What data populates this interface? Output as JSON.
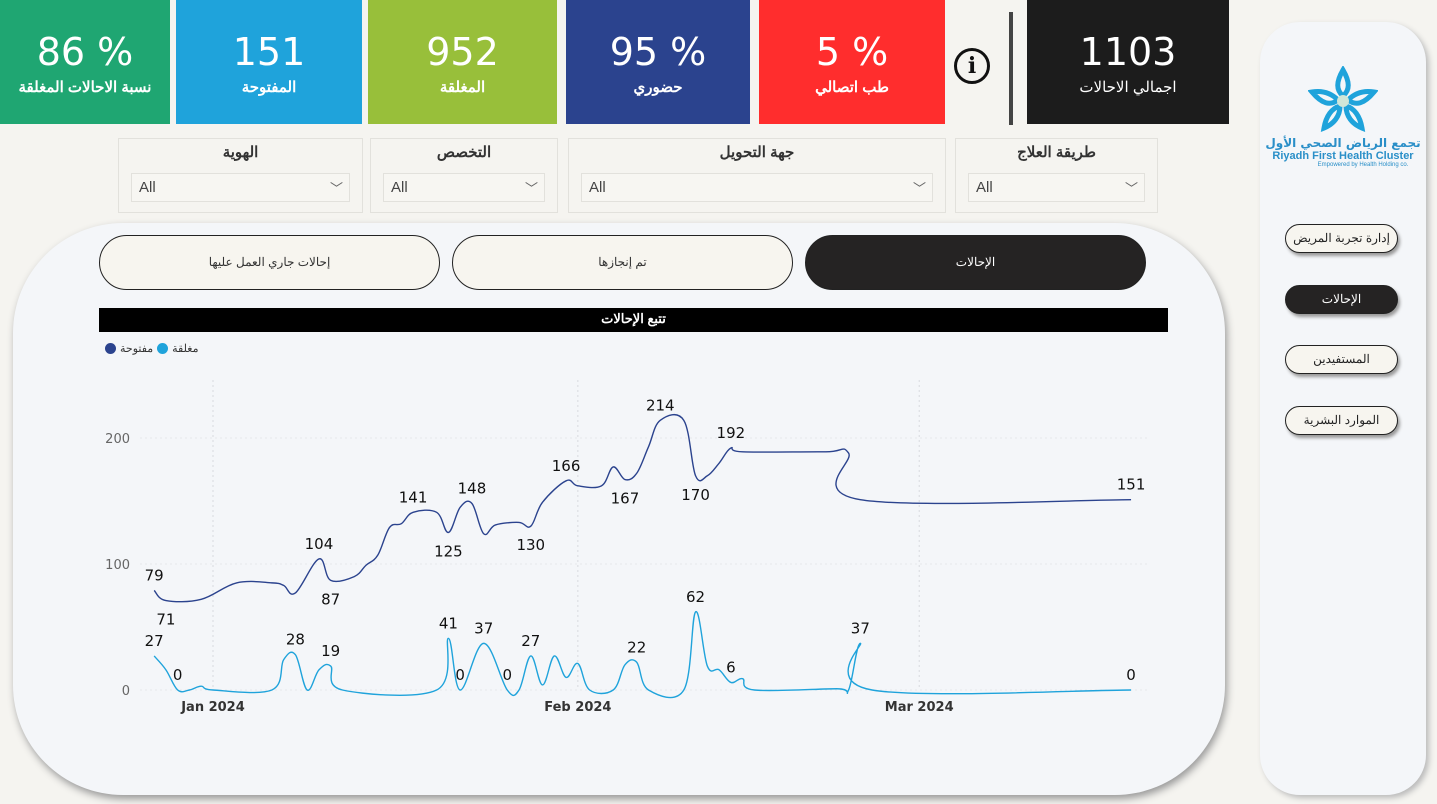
{
  "kpis": [
    {
      "value": "86 %",
      "label": "نسبة الاحالات المغلقة",
      "color": "#1fa672"
    },
    {
      "value": "151",
      "label": "المفتوحة",
      "color": "#1fa3db"
    },
    {
      "value": "952",
      "label": "المغلقة",
      "color": "#98bf3a"
    },
    {
      "value": "95 %",
      "label": "حضوري",
      "color": "#2b438e"
    },
    {
      "value": "5 %",
      "label": "طب اتصالي",
      "color": "#ff2d2d"
    },
    {
      "value": "1103",
      "label": "اجمالي الاحالات",
      "color": "#1c1c1c"
    }
  ],
  "info_icon": "info-circle-icon",
  "filters": [
    {
      "title": "الهوية",
      "value": "All"
    },
    {
      "title": "التخصص",
      "value": "All"
    },
    {
      "title": "جهة التحويل",
      "value": "All"
    },
    {
      "title": "طريقة العلاج",
      "value": "All"
    }
  ],
  "logo": {
    "arabic": "تجمع الرياض الصحي الأول",
    "english": "Riyadh First Health Cluster",
    "tagline": "Empowered by Health Holding co."
  },
  "nav": [
    "إدارة تجربة المريض",
    "الإحالات",
    "المستفيدين",
    "الموارد البشرية"
  ],
  "nav_active": 1,
  "tabs": [
    "إحالات جاري العمل عليها",
    "تم إنجازها",
    "الإحالات"
  ],
  "tab_active": 2,
  "chart_data": {
    "type": "line",
    "title": "تتبع الإحالات",
    "legend": {
      "position": "top-left"
    },
    "ylim": [
      0,
      246
    ],
    "yticks": [
      0,
      100,
      200
    ],
    "xticks": [
      {
        "date": "2024-01-01",
        "label": "Jan 2024"
      },
      {
        "date": "2024-02-01",
        "label": "Feb 2024"
      },
      {
        "date": "2024-03-01",
        "label": "Mar 2024"
      }
    ],
    "grid": true,
    "series": [
      {
        "name": "مفتوحة",
        "color": "#2b438e",
        "points": [
          [
            "2023-12-27",
            79
          ],
          [
            "2023-12-28",
            71
          ],
          [
            "2023-12-31",
            72
          ],
          [
            "2024-01-03",
            85
          ],
          [
            "2024-01-06",
            85
          ],
          [
            "2024-01-07",
            83
          ],
          [
            "2024-01-08",
            77
          ],
          [
            "2024-01-10",
            104
          ],
          [
            "2024-01-11",
            87
          ],
          [
            "2024-01-13",
            90
          ],
          [
            "2024-01-14",
            99
          ],
          [
            "2024-01-15",
            107
          ],
          [
            "2024-01-16",
            129
          ],
          [
            "2024-01-17",
            132
          ],
          [
            "2024-01-18",
            141
          ],
          [
            "2024-01-20",
            141
          ],
          [
            "2024-01-21",
            125
          ],
          [
            "2024-01-22",
            145
          ],
          [
            "2024-01-23",
            148
          ],
          [
            "2024-01-24",
            124
          ],
          [
            "2024-01-25",
            131
          ],
          [
            "2024-01-27",
            133
          ],
          [
            "2024-01-28",
            130
          ],
          [
            "2024-01-29",
            149
          ],
          [
            "2024-01-31",
            166
          ],
          [
            "2024-02-01",
            162
          ],
          [
            "2024-02-03",
            162
          ],
          [
            "2024-02-04",
            177
          ],
          [
            "2024-02-05",
            167
          ],
          [
            "2024-02-06",
            172
          ],
          [
            "2024-02-07",
            193
          ],
          [
            "2024-02-08",
            214
          ],
          [
            "2024-02-10",
            214
          ],
          [
            "2024-02-11",
            170
          ],
          [
            "2024-02-12",
            170
          ],
          [
            "2024-02-13",
            180
          ],
          [
            "2024-02-14",
            192
          ],
          [
            "2024-02-15",
            189
          ],
          [
            "2024-02-22",
            189
          ],
          [
            "2024-02-24",
            188
          ],
          [
            "2024-02-25",
            151
          ],
          [
            "2024-03-19",
            151
          ]
        ],
        "labels": [
          [
            "2023-12-27",
            79,
            "above"
          ],
          [
            "2023-12-28",
            71,
            "below"
          ],
          [
            "2024-01-10",
            104,
            "above"
          ],
          [
            "2024-01-11",
            87,
            "below"
          ],
          [
            "2024-01-18",
            141,
            "above"
          ],
          [
            "2024-01-21",
            125,
            "below"
          ],
          [
            "2024-01-23",
            148,
            "above"
          ],
          [
            "2024-01-28",
            130,
            "below"
          ],
          [
            "2024-01-31",
            166,
            "above"
          ],
          [
            "2024-02-05",
            167,
            "below"
          ],
          [
            "2024-02-08",
            214,
            "above"
          ],
          [
            "2024-02-11",
            170,
            "below"
          ],
          [
            "2024-02-14",
            192,
            "above"
          ],
          [
            "2024-03-19",
            151,
            "above"
          ]
        ]
      },
      {
        "name": "مغلقة",
        "color": "#1fa3db",
        "points": [
          [
            "2023-12-27",
            27
          ],
          [
            "2023-12-28",
            16
          ],
          [
            "2023-12-29",
            0
          ],
          [
            "2023-12-30",
            0
          ],
          [
            "2023-12-31",
            3
          ],
          [
            "2024-01-01",
            0
          ],
          [
            "2024-01-06",
            0
          ],
          [
            "2024-01-07",
            24
          ],
          [
            "2024-01-08",
            28
          ],
          [
            "2024-01-09",
            0
          ],
          [
            "2024-01-10",
            16
          ],
          [
            "2024-01-11",
            19
          ],
          [
            "2024-01-12",
            0
          ],
          [
            "2024-01-20",
            0
          ],
          [
            "2024-01-21",
            41
          ],
          [
            "2024-01-22",
            0
          ],
          [
            "2024-01-24",
            37
          ],
          [
            "2024-01-26",
            0
          ],
          [
            "2024-01-27",
            0
          ],
          [
            "2024-01-28",
            27
          ],
          [
            "2024-01-29",
            4
          ],
          [
            "2024-01-30",
            27
          ],
          [
            "2024-01-31",
            10
          ],
          [
            "2024-02-01",
            21
          ],
          [
            "2024-02-02",
            0
          ],
          [
            "2024-02-04",
            0
          ],
          [
            "2024-02-05",
            20
          ],
          [
            "2024-02-06",
            22
          ],
          [
            "2024-02-07",
            0
          ],
          [
            "2024-02-10",
            0
          ],
          [
            "2024-02-11",
            62
          ],
          [
            "2024-02-12",
            19
          ],
          [
            "2024-02-13",
            16
          ],
          [
            "2024-02-14",
            6
          ],
          [
            "2024-02-15",
            9
          ],
          [
            "2024-02-16",
            0
          ],
          [
            "2024-02-23",
            1
          ],
          [
            "2024-02-24",
            0
          ],
          [
            "2024-02-25",
            37
          ],
          [
            "2024-02-26",
            0
          ],
          [
            "2024-03-19",
            0
          ]
        ],
        "labels": [
          [
            "2023-12-27",
            27,
            "above"
          ],
          [
            "2023-12-29",
            0,
            "above"
          ],
          [
            "2024-01-08",
            28,
            "above"
          ],
          [
            "2024-01-11",
            19,
            "above"
          ],
          [
            "2024-01-21",
            41,
            "above"
          ],
          [
            "2024-01-22",
            0,
            "above"
          ],
          [
            "2024-01-24",
            37,
            "above"
          ],
          [
            "2024-01-26",
            0,
            "above"
          ],
          [
            "2024-01-28",
            27,
            "above"
          ],
          [
            "2024-02-06",
            22,
            "above"
          ],
          [
            "2024-02-11",
            62,
            "above"
          ],
          [
            "2024-02-14",
            6,
            "above"
          ],
          [
            "2024-02-25",
            37,
            "above"
          ],
          [
            "2024-03-19",
            0,
            "above"
          ]
        ]
      }
    ]
  }
}
